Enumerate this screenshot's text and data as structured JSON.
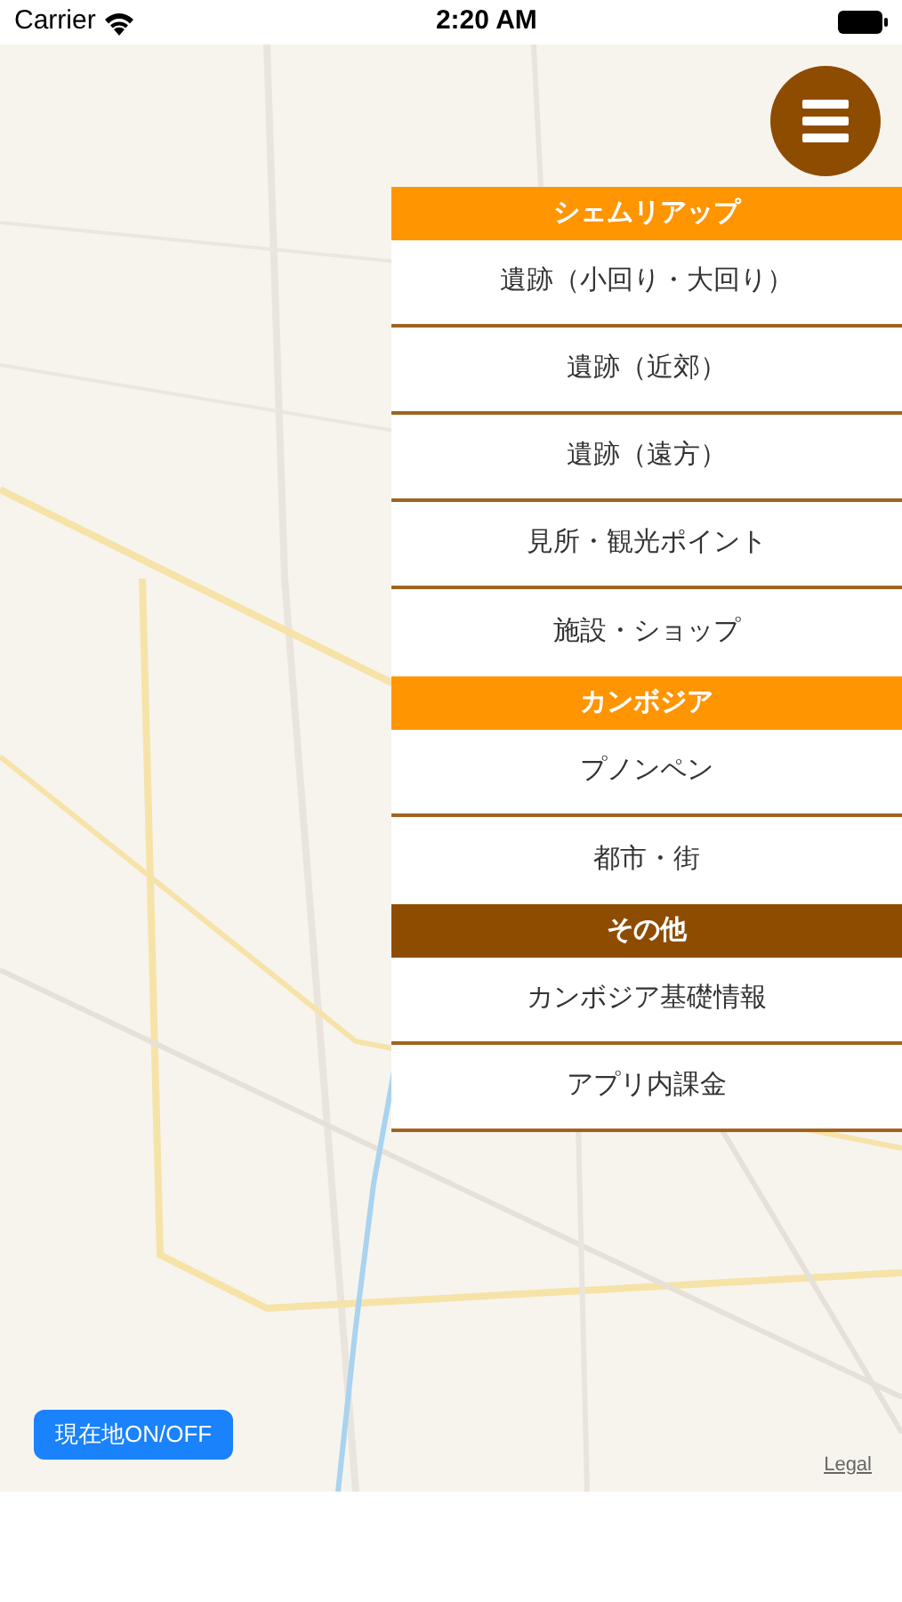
{
  "status_bar": {
    "carrier": "Carrier",
    "time": "2:20 AM"
  },
  "menu_sections": [
    {
      "title": "シェムリアップ",
      "color": "#ff9500",
      "items": [
        "遺跡（小回り・大回り）",
        "遺跡（近郊）",
        "遺跡（遠方）",
        "見所・観光ポイント",
        "施設・ショップ"
      ]
    },
    {
      "title": "カンボジア",
      "color": "#ff9500",
      "items": [
        "プノンペン",
        "都市・街"
      ]
    },
    {
      "title": "その他",
      "color": "#8e4c00",
      "items": [
        "カンボジア基礎情報",
        "アプリ内課金"
      ]
    }
  ],
  "location_button": "現在地ON/OFF",
  "legal_link": "Legal"
}
